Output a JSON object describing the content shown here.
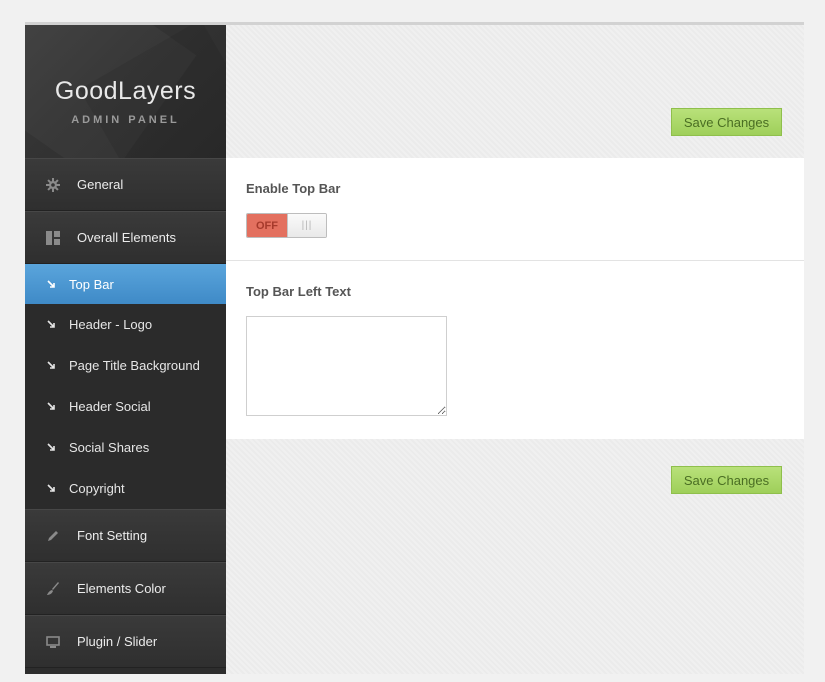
{
  "brand": {
    "name": "GoodLayers",
    "subtitle": "ADMIN PANEL"
  },
  "sidebar": {
    "menu_top": [
      {
        "label": "General",
        "icon": "gear-icon"
      },
      {
        "label": "Overall Elements",
        "icon": "layout-icon"
      }
    ],
    "submenu": [
      {
        "label": "Top Bar",
        "active": true
      },
      {
        "label": "Header - Logo"
      },
      {
        "label": "Page Title Background"
      },
      {
        "label": "Header Social"
      },
      {
        "label": "Social Shares"
      },
      {
        "label": "Copyright"
      }
    ],
    "menu_bottom": [
      {
        "label": "Font Setting",
        "icon": "pencil-icon"
      },
      {
        "label": "Elements Color",
        "icon": "brush-icon"
      },
      {
        "label": "Plugin / Slider",
        "icon": "monitor-icon"
      }
    ]
  },
  "main": {
    "save_label": "Save Changes",
    "enable_top_bar": {
      "label": "Enable Top Bar",
      "state": "OFF"
    },
    "top_bar_left_text": {
      "label": "Top Bar Left Text",
      "value": ""
    }
  },
  "colors": {
    "active_blue": "#4a97d2",
    "save_green": "#a8d666",
    "off_red": "#e3705f"
  }
}
